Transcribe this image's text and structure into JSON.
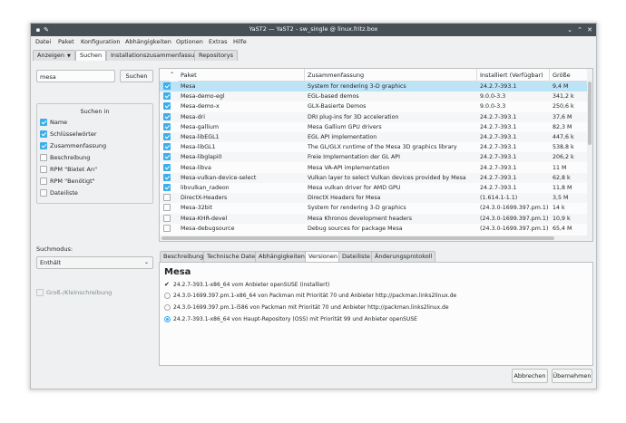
{
  "window": {
    "title": "YaST2 — YaST2 - sw_single @ linux.fritz.box"
  },
  "menu": [
    "Datei",
    "Paket",
    "Konfiguration",
    "Abhängigkeiten",
    "Optionen",
    "Extras",
    "Hilfe"
  ],
  "top_tabs": {
    "view": "Anzeigen",
    "search": "Suchen",
    "summary": "Installationszusammenfassung",
    "repos": "Repositorys"
  },
  "search": {
    "value": "mesa",
    "button": "Suchen",
    "group_title": "Suchen in",
    "options": [
      {
        "label": "Name",
        "checked": true,
        "enabled": true
      },
      {
        "label": "Schlüsselwörter",
        "checked": true,
        "enabled": true
      },
      {
        "label": "Zusammenfassung",
        "checked": true,
        "enabled": true
      },
      {
        "label": "Beschreibung",
        "checked": false,
        "enabled": true
      },
      {
        "label": "RPM \"Bietet An\"",
        "checked": false,
        "enabled": true
      },
      {
        "label": "RPM \"Benötigt\"",
        "checked": false,
        "enabled": true
      },
      {
        "label": "Dateiliste",
        "checked": false,
        "enabled": true
      }
    ],
    "mode_label": "Suchmodus:",
    "mode_value": "Enthält",
    "case_label": "Groß-/Kleinschreibung"
  },
  "table": {
    "columns": [
      "Paket",
      "Zusammenfassung",
      "Installiert (Verfügbar)",
      "Größe"
    ],
    "rows": [
      {
        "checked": true,
        "name": "Mesa",
        "summary": "System for rendering 3-D graphics",
        "version": "24.2.7-393.1",
        "size": "9,4 M",
        "selected": true
      },
      {
        "checked": true,
        "name": "Mesa-demo-egl",
        "summary": "EGL-based demos",
        "version": "9.0.0-3.3",
        "size": "341,2 k"
      },
      {
        "checked": true,
        "name": "Mesa-demo-x",
        "summary": "GLX-Basierte Demos",
        "version": "9.0.0-3.3",
        "size": "250,6 k"
      },
      {
        "checked": true,
        "name": "Mesa-dri",
        "summary": "DRI plug-ins for 3D acceleration",
        "version": "24.2.7-393.1",
        "size": "37,6 M"
      },
      {
        "checked": true,
        "name": "Mesa-gallium",
        "summary": "Mesa Gallium GPU drivers",
        "version": "24.2.7-393.1",
        "size": "82,3 M"
      },
      {
        "checked": true,
        "name": "Mesa-libEGL1",
        "summary": "EGL API implementation",
        "version": "24.2.7-393.1",
        "size": "447,6 k"
      },
      {
        "checked": true,
        "name": "Mesa-libGL1",
        "summary": "The GL/GLX runtime of the Mesa 3D graphics library",
        "version": "24.2.7-393.1",
        "size": "538,8 k"
      },
      {
        "checked": true,
        "name": "Mesa-libglapi0",
        "summary": "Freie Implementation der GL API",
        "version": "24.2.7-393.1",
        "size": "206,2 k"
      },
      {
        "checked": true,
        "name": "Mesa-libva",
        "summary": "Mesa VA-API implementation",
        "version": "24.2.7-393.1",
        "size": "11 M"
      },
      {
        "checked": true,
        "name": "Mesa-vulkan-device-select",
        "summary": "Vulkan layer to select Vulkan devices provided by Mesa",
        "version": "24.2.7-393.1",
        "size": "62,8 k"
      },
      {
        "checked": true,
        "name": "libvulkan_radeon",
        "summary": "Mesa vulkan driver for AMD GPU",
        "version": "24.2.7-393.1",
        "size": "11,8 M"
      },
      {
        "checked": false,
        "name": "DirectX-Headers",
        "summary": "DirectX Headers for Mesa",
        "version": "(1.614.1-1.1)",
        "size": "3,5 M"
      },
      {
        "checked": false,
        "name": "Mesa-32bit",
        "summary": "System for rendering 3-D graphics",
        "version": "(24.3.0-1699.397.pm.1)",
        "size": "14 k"
      },
      {
        "checked": false,
        "name": "Mesa-KHR-devel",
        "summary": "Mesa Khronos development headers",
        "version": "(24.3.0-1699.397.pm.1)",
        "size": "10,9 k"
      },
      {
        "checked": false,
        "name": "Mesa-debugsource",
        "summary": "Debug sources for package Mesa",
        "version": "(24.3.0-1699.397.pm.1)",
        "size": "65,4 M"
      }
    ]
  },
  "detail_tabs": [
    "Beschreibung",
    "Technische Daten",
    "Abhängigkeiten",
    "Versionen",
    "Dateiliste",
    "Änderungsprotokoll"
  ],
  "details": {
    "package": "Mesa",
    "versions": [
      {
        "type": "check",
        "text": "24.2.7-393.1-x86_64 vom Anbieter openSUSE (installiert)"
      },
      {
        "type": "radio",
        "selected": false,
        "text": "24.3.0-1699.397.pm.1-x86_64 von Packman mit Priorität 70 und Anbieter http://packman.links2linux.de"
      },
      {
        "type": "radio",
        "selected": false,
        "text": "24.3.0-1699.397.pm.1-i586 von Packman mit Priorität 70 und Anbieter http://packman.links2linux.de"
      },
      {
        "type": "radio",
        "selected": true,
        "text": "24.2.7-393.1-x86_64 von Haupt-Repository (OSS) mit Priorität 99 und Anbieter openSUSE"
      }
    ]
  },
  "buttons": {
    "cancel": "Abbrechen",
    "accept": "Übernehmen"
  }
}
